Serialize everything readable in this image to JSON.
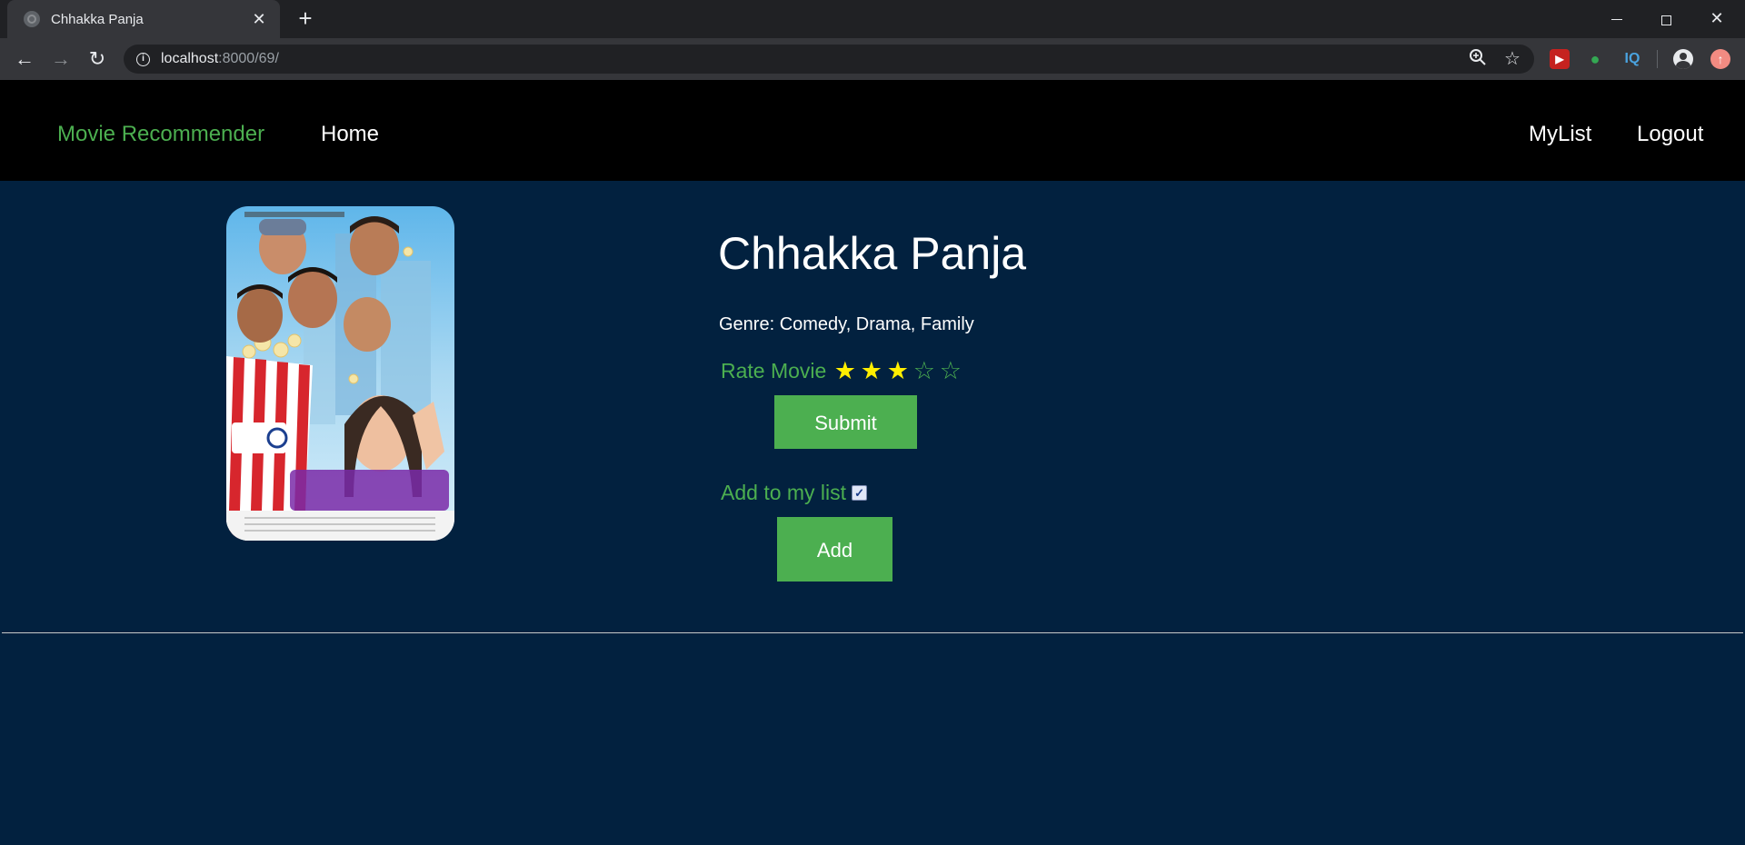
{
  "browser": {
    "tab_title": "Chhakka Panja",
    "url_host": "localhost",
    "url_rest": ":8000/69/",
    "ext_iq_label": "IQ"
  },
  "navbar": {
    "brand": "Movie Recommender",
    "home": "Home",
    "mylist": "MyList",
    "logout": "Logout"
  },
  "movie": {
    "title": "Chhakka Panja",
    "genre": "Genre: Comedy, Drama, Family",
    "rate_label": "Rate Movie",
    "rating": 3,
    "rating_max": 5,
    "submit_label": "Submit",
    "add_list_label": "Add to my list",
    "add_list_checked": true,
    "add_label": "Add"
  },
  "colors": {
    "page_bg": "#02213f",
    "accent_green": "#4caf50",
    "star_filled": "#ffee00",
    "navbar_bg": "#000000"
  }
}
